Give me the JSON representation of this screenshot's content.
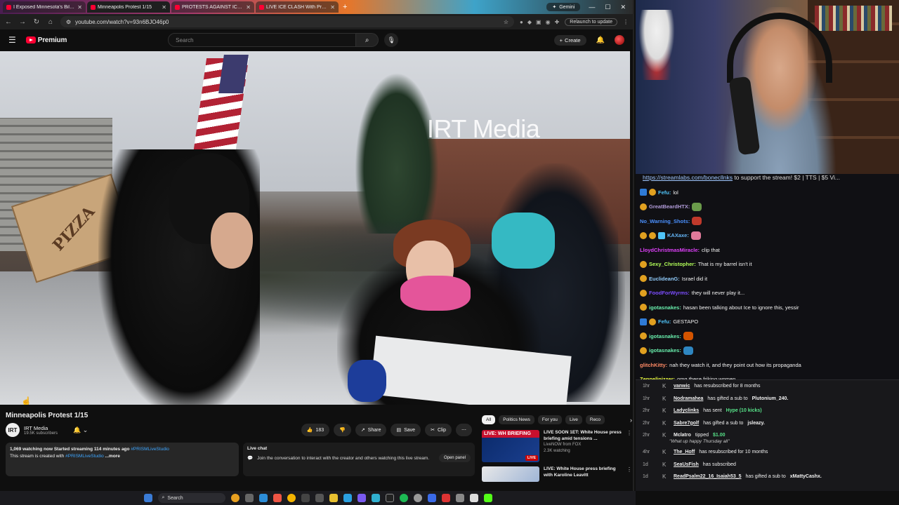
{
  "browser": {
    "tabs": [
      {
        "title": "I Exposed Minnesota's Billion Do"
      },
      {
        "title": "Minneapolis Protest 1/15"
      },
      {
        "title": "PROTESTS AGAINST ICE CONT"
      },
      {
        "title": "LIVE ICE CLASH With Protester"
      }
    ],
    "right_tab": "Gemini",
    "url": "youtube.com/watch?v=93n6BJO46p0",
    "relaunch": "Relaunch to update"
  },
  "youtube": {
    "logo": "Premium",
    "search_placeholder": "Search",
    "create_label": "Create",
    "video": {
      "watermark": "IRT Media",
      "pizza_box_text": "PIZZA",
      "title": "Minneapolis Protest 1/15"
    },
    "channel": {
      "initials": "IRT",
      "name": "IRT Media",
      "subs": "19.5K subscribers"
    },
    "actions": {
      "likes": "183",
      "share": "Share",
      "save": "Save",
      "clip": "Clip"
    },
    "description": {
      "stats": "1,069 watching now  Started streaming 114 minutes ago",
      "hashtag": "#PRISMLiveStudio",
      "line2_prefix": "This stream is created with",
      "line2_link": "#PRISMLiveStudio",
      "more": "...more"
    },
    "live_chat": {
      "title": "Live chat",
      "body": "Join the conversation to interact with the creator and others watching this live stream.",
      "button": "Open panel"
    },
    "chips": [
      "All",
      "Politics News",
      "For you",
      "Live",
      "Reco"
    ],
    "recs": [
      {
        "thumb_label": "LIVE: WH BRIEFING",
        "badge": "LIVE",
        "title": "LIVE SOON 1ET: White House press briefing amid tensions ...",
        "channel": "LiveNOW from FOX",
        "meta": "2.3K watching"
      },
      {
        "title": "LIVE: White House press briefing with Karoline Leavitt"
      }
    ]
  },
  "stream": {
    "link_bar": {
      "link": "https://streamlabs.com/bonecllnks",
      "text": " to support the stream! $2 | TTS | $5 Vi..."
    },
    "messages": [
      {
        "user": "Fefu:",
        "text": "lol",
        "color": "#4fc3f7",
        "badges": [
          "blue",
          "gold"
        ]
      },
      {
        "user": "GreatBeardHTX:",
        "text": "",
        "color": "#b39ddb",
        "badges": [
          "gold"
        ],
        "emote": "#6a9a4a"
      },
      {
        "user": "No_Warning_Shots:",
        "text": "",
        "color": "#4a90ff",
        "badges": [],
        "emote": "#c0392b"
      },
      {
        "user": "KAXaxe:",
        "text": "",
        "color": "#64b5f6",
        "badges": [
          "gold",
          "gold",
          "cyan"
        ],
        "emote": "#e07a9a"
      },
      {
        "user": "LloydChristmasMiracle:",
        "text": "clip that",
        "color": "#e040fb",
        "badges": []
      },
      {
        "user": "Sexy_Christopher:",
        "text": "That is my barrel isn't it",
        "color": "#b2ff59",
        "badges": [
          "gold"
        ]
      },
      {
        "user": "EuclideanG:",
        "text": "Israel did it",
        "color": "#90caf9",
        "badges": [
          "gold"
        ]
      },
      {
        "user": "FoodForWyrms:",
        "text": "they will never play it...",
        "color": "#7c4dff",
        "badges": [
          "gold"
        ]
      },
      {
        "user": "igotasnakes:",
        "text": "hasan been talking about Ice to ignore this, yessir",
        "color": "#69f0ae",
        "badges": [
          "gold"
        ]
      },
      {
        "user": "Fefu:",
        "text": "GESTAPO",
        "color": "#4fc3f7",
        "badges": [
          "blue",
          "gold"
        ]
      },
      {
        "user": "igotasnakes:",
        "text": "",
        "color": "#69f0ae",
        "badges": [
          "gold"
        ],
        "emote": "#d35400"
      },
      {
        "user": "igotasnakes:",
        "text": "",
        "color": "#69f0ae",
        "badges": [
          "gold"
        ],
        "emote": "#2e86c1"
      },
      {
        "user": "glitchKitty:",
        "text": "nah they watch it, and they point out how its propaganda",
        "color": "#ff8a65",
        "badges": []
      },
      {
        "user": "Zeppelinizzer:",
        "text": "omg these friking women",
        "color": "#eeff41",
        "badges": []
      }
    ],
    "events": [
      {
        "time": "1hr",
        "user": "vanwic",
        "text": "has resubscribed for 8 months"
      },
      {
        "time": "1hr",
        "user": "Nodramahea",
        "text": "has gifted a sub to",
        "target": "Plutonium_240."
      },
      {
        "time": "2hr",
        "user": "Ladyclinks",
        "text": "has sent",
        "amount": "Hype (10 kicks)"
      },
      {
        "time": "2hr",
        "user": "Sabre7golf",
        "text": "has gifted a sub to",
        "target": "jsleazy."
      },
      {
        "time": "2hr",
        "user": "Mclatro",
        "text": "tipped",
        "amount": "$1.00",
        "sub": "\"What up happy Thursday all\""
      },
      {
        "time": "4hr",
        "user": "The_Hoff",
        "text": "has resubscribed for 10 months"
      },
      {
        "time": "1d",
        "user": "SeaUsFish",
        "text": "has subscribed"
      },
      {
        "time": "1d",
        "user": "ReadPsalm22_16_Isaiah53_5",
        "text": "has gifted a sub to",
        "target": "xMattyCashx."
      }
    ]
  },
  "taskbar": {
    "search": "Search"
  }
}
